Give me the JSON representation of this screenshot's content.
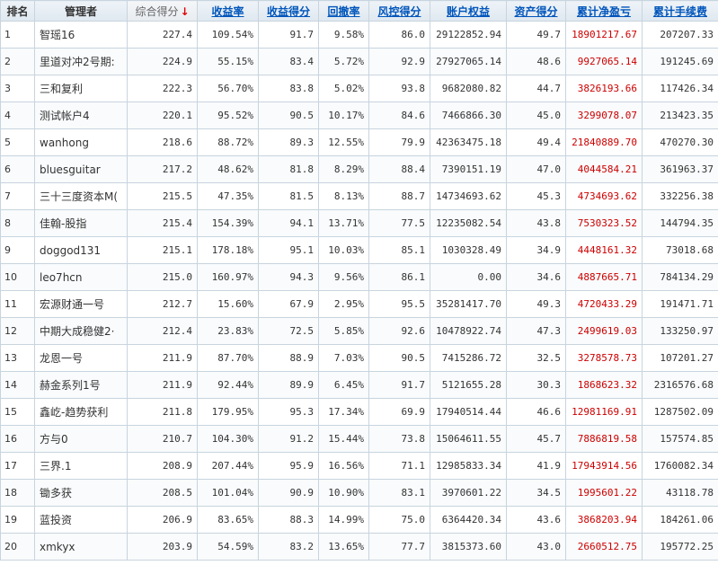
{
  "headers": {
    "rank": "排名",
    "manager": "管理者",
    "score": "综合得分",
    "return_rate": "收益率",
    "return_score": "收益得分",
    "drawdown": "回撤率",
    "risk_score": "风控得分",
    "equity": "账户权益",
    "asset_score": "资产得分",
    "net_pnl": "累计净盈亏",
    "fees": "累计手续费",
    "sort_arrow": "↓"
  },
  "colors": {
    "link": "#0055bb",
    "pnl": "#cc0000",
    "sort_arrow": "#dd0000"
  },
  "rows": [
    {
      "rank": "1",
      "name": "智瑶16",
      "score": "227.4",
      "return_rate": "109.54%",
      "return_score": "91.7",
      "drawdown": "9.58%",
      "risk_score": "86.0",
      "equity": "29122852.94",
      "asset_score": "49.7",
      "net_pnl": "18901217.67",
      "fees": "207207.33"
    },
    {
      "rank": "2",
      "name": "里道对冲2号期:",
      "score": "224.9",
      "return_rate": "55.15%",
      "return_score": "83.4",
      "drawdown": "5.72%",
      "risk_score": "92.9",
      "equity": "27927065.14",
      "asset_score": "48.6",
      "net_pnl": "9927065.14",
      "fees": "191245.69"
    },
    {
      "rank": "3",
      "name": "三和复利",
      "score": "222.3",
      "return_rate": "56.70%",
      "return_score": "83.8",
      "drawdown": "5.02%",
      "risk_score": "93.8",
      "equity": "9682080.82",
      "asset_score": "44.7",
      "net_pnl": "3826193.66",
      "fees": "117426.34"
    },
    {
      "rank": "4",
      "name": "测试帐户4",
      "score": "220.1",
      "return_rate": "95.52%",
      "return_score": "90.5",
      "drawdown": "10.17%",
      "risk_score": "84.6",
      "equity": "7466866.30",
      "asset_score": "45.0",
      "net_pnl": "3299078.07",
      "fees": "213423.35"
    },
    {
      "rank": "5",
      "name": "wanhong",
      "score": "218.6",
      "return_rate": "88.72%",
      "return_score": "89.3",
      "drawdown": "12.55%",
      "risk_score": "79.9",
      "equity": "42363475.18",
      "asset_score": "49.4",
      "net_pnl": "21840889.70",
      "fees": "470270.30"
    },
    {
      "rank": "6",
      "name": "bluesguitar",
      "score": "217.2",
      "return_rate": "48.62%",
      "return_score": "81.8",
      "drawdown": "8.29%",
      "risk_score": "88.4",
      "equity": "7390151.19",
      "asset_score": "47.0",
      "net_pnl": "4044584.21",
      "fees": "361963.37"
    },
    {
      "rank": "7",
      "name": "三十三度资本M(",
      "score": "215.5",
      "return_rate": "47.35%",
      "return_score": "81.5",
      "drawdown": "8.13%",
      "risk_score": "88.7",
      "equity": "14734693.62",
      "asset_score": "45.3",
      "net_pnl": "4734693.62",
      "fees": "332256.38"
    },
    {
      "rank": "8",
      "name": "佳翰-股指",
      "score": "215.4",
      "return_rate": "154.39%",
      "return_score": "94.1",
      "drawdown": "13.71%",
      "risk_score": "77.5",
      "equity": "12235082.54",
      "asset_score": "43.8",
      "net_pnl": "7530323.52",
      "fees": "144794.35"
    },
    {
      "rank": "9",
      "name": "doggod131",
      "score": "215.1",
      "return_rate": "178.18%",
      "return_score": "95.1",
      "drawdown": "10.03%",
      "risk_score": "85.1",
      "equity": "1030328.49",
      "asset_score": "34.9",
      "net_pnl": "4448161.32",
      "fees": "73018.68"
    },
    {
      "rank": "10",
      "name": "leo7hcn",
      "score": "215.0",
      "return_rate": "160.97%",
      "return_score": "94.3",
      "drawdown": "9.56%",
      "risk_score": "86.1",
      "equity": "0.00",
      "asset_score": "34.6",
      "net_pnl": "4887665.71",
      "fees": "784134.29"
    },
    {
      "rank": "11",
      "name": "宏源财通一号",
      "score": "212.7",
      "return_rate": "15.60%",
      "return_score": "67.9",
      "drawdown": "2.95%",
      "risk_score": "95.5",
      "equity": "35281417.70",
      "asset_score": "49.3",
      "net_pnl": "4720433.29",
      "fees": "191471.71"
    },
    {
      "rank": "12",
      "name": "中期大成稳健2·",
      "score": "212.4",
      "return_rate": "23.83%",
      "return_score": "72.5",
      "drawdown": "5.85%",
      "risk_score": "92.6",
      "equity": "10478922.74",
      "asset_score": "47.3",
      "net_pnl": "2499619.03",
      "fees": "133250.97"
    },
    {
      "rank": "13",
      "name": "龙恩一号",
      "score": "211.9",
      "return_rate": "87.70%",
      "return_score": "88.9",
      "drawdown": "7.03%",
      "risk_score": "90.5",
      "equity": "7415286.72",
      "asset_score": "32.5",
      "net_pnl": "3278578.73",
      "fees": "107201.27"
    },
    {
      "rank": "14",
      "name": "赫金系列1号",
      "score": "211.9",
      "return_rate": "92.44%",
      "return_score": "89.9",
      "drawdown": "6.45%",
      "risk_score": "91.7",
      "equity": "5121655.28",
      "asset_score": "30.3",
      "net_pnl": "1868623.32",
      "fees": "2316576.68"
    },
    {
      "rank": "15",
      "name": "鑫屹-趋势获利",
      "score": "211.8",
      "return_rate": "179.95%",
      "return_score": "95.3",
      "drawdown": "17.34%",
      "risk_score": "69.9",
      "equity": "17940514.44",
      "asset_score": "46.6",
      "net_pnl": "12981169.91",
      "fees": "1287502.09"
    },
    {
      "rank": "16",
      "name": "方与0",
      "score": "210.7",
      "return_rate": "104.30%",
      "return_score": "91.2",
      "drawdown": "15.44%",
      "risk_score": "73.8",
      "equity": "15064611.55",
      "asset_score": "45.7",
      "net_pnl": "7886819.58",
      "fees": "157574.85"
    },
    {
      "rank": "17",
      "name": "三界.1",
      "score": "208.9",
      "return_rate": "207.44%",
      "return_score": "95.9",
      "drawdown": "16.56%",
      "risk_score": "71.1",
      "equity": "12985833.34",
      "asset_score": "41.9",
      "net_pnl": "17943914.56",
      "fees": "1760082.34"
    },
    {
      "rank": "18",
      "name": "锄多获",
      "score": "208.5",
      "return_rate": "101.04%",
      "return_score": "90.9",
      "drawdown": "10.90%",
      "risk_score": "83.1",
      "equity": "3970601.22",
      "asset_score": "34.5",
      "net_pnl": "1995601.22",
      "fees": "43118.78"
    },
    {
      "rank": "19",
      "name": "蓝投资",
      "score": "206.9",
      "return_rate": "83.65%",
      "return_score": "88.3",
      "drawdown": "14.99%",
      "risk_score": "75.0",
      "equity": "6364420.34",
      "asset_score": "43.6",
      "net_pnl": "3868203.94",
      "fees": "184261.06"
    },
    {
      "rank": "20",
      "name": "xmkyx",
      "score": "203.9",
      "return_rate": "54.59%",
      "return_score": "83.2",
      "drawdown": "13.65%",
      "risk_score": "77.7",
      "equity": "3815373.60",
      "asset_score": "43.0",
      "net_pnl": "2660512.75",
      "fees": "195772.25"
    }
  ]
}
